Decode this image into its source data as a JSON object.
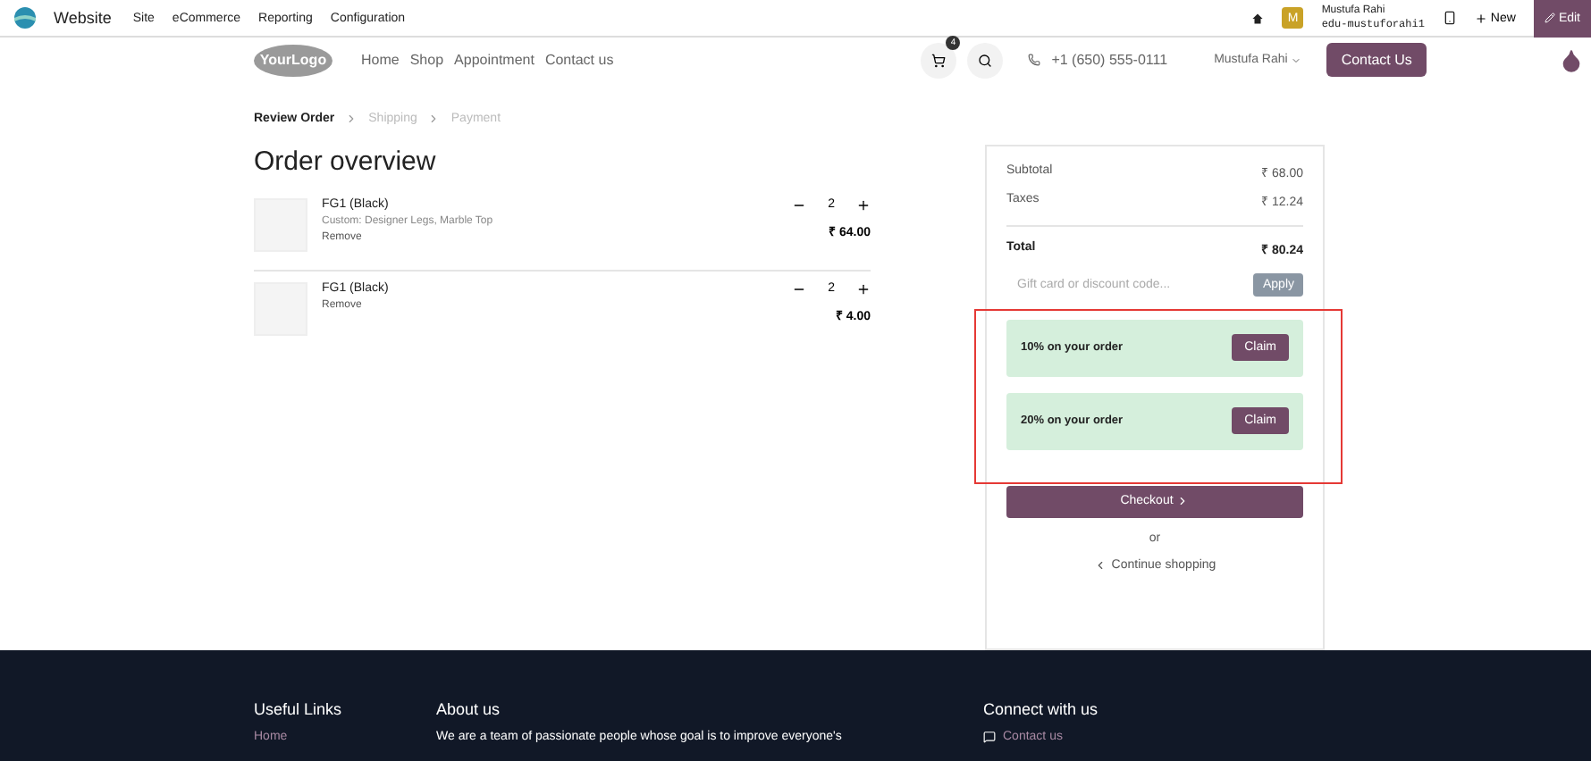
{
  "admin_bar": {
    "app": "Website",
    "menu": [
      "Site",
      "eCommerce",
      "Reporting",
      "Configuration"
    ],
    "user_initial": "M",
    "user_name": "Mustufa Rahi",
    "user_db": "edu-mustuforahi1",
    "new_label": "New",
    "edit_label": "Edit"
  },
  "navbar": {
    "logo": "YourLogo",
    "links": [
      "Home",
      "Shop",
      "Appointment",
      "Contact us"
    ],
    "cart_count": "4",
    "phone": "+1 (650) 555-0111",
    "user": "Mustufa Rahi",
    "cta": "Contact Us"
  },
  "steps": [
    {
      "label": "Review Order",
      "selected": true
    },
    {
      "label": "Shipping",
      "selected": false
    },
    {
      "label": "Payment",
      "selected": false
    }
  ],
  "title": "Order overview",
  "lines": [
    {
      "name": "FG1 (Black)",
      "detail": "Custom: Designer Legs, Marble Top",
      "remove": "Remove",
      "qty": "2",
      "price": "₹ 64.00"
    },
    {
      "name": "FG1 (Black)",
      "remove": "Remove",
      "qty": "2",
      "price": "₹ 4.00"
    }
  ],
  "summary": {
    "rows": [
      {
        "label": "Subtotal",
        "value": "₹ 68.00"
      },
      {
        "label": "Taxes",
        "value": "₹ 12.24"
      }
    ],
    "total_label": "Total",
    "total_value": "₹ 80.24",
    "code_placeholder": "Gift card or discount code...",
    "apply": "Apply",
    "rewards": [
      {
        "label": "10% on your order",
        "button": "Claim"
      },
      {
        "label": "20% on your order",
        "button": "Claim"
      }
    ],
    "checkout": "Checkout",
    "or": "or",
    "continue": "Continue shopping"
  },
  "footer": {
    "columns": [
      {
        "title": "Useful Links",
        "items": [
          "Home"
        ]
      },
      {
        "title": "About us",
        "items": [
          "We are a team of passionate people whose goal is to improve everyone's"
        ]
      },
      {
        "title": "Connect with us",
        "items": [
          "Contact us"
        ]
      }
    ]
  }
}
